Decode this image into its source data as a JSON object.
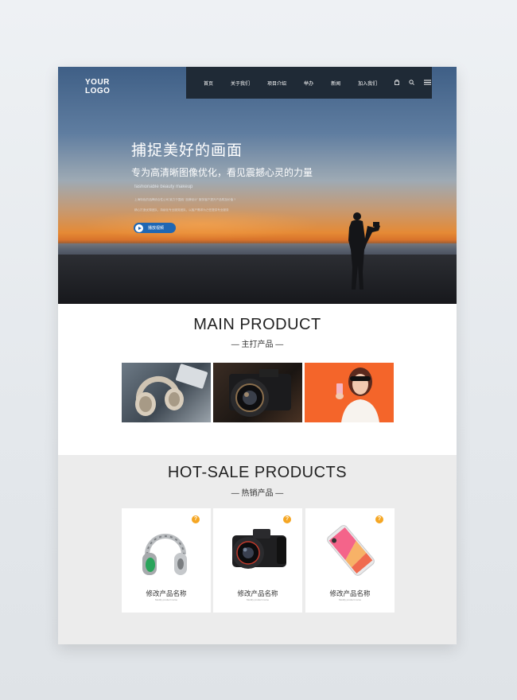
{
  "brand": {
    "logo_line1": "YOUR",
    "logo_line2": "LOGO"
  },
  "nav": {
    "items": [
      "首页",
      "关于我们",
      "项目介绍",
      "举办",
      "新闻",
      "加入我们"
    ],
    "icons": [
      "bag-icon",
      "search-icon",
      "menu-icon"
    ]
  },
  "hero": {
    "title": "捕捉美好的画面",
    "subtitle": "专为高清晰图像优化，看见震撼心灵的力量",
    "tagline": "fashionable beauty makeup",
    "line1": "上海特色的品牌综合性公司 致力于围绕 \"品牌设计\" 服务客户提升产品附加价值 ?",
    "line2": "精心打造优秀团队，持续化专业服务团队，以客户需求为己任提供专业服务",
    "play_label": "播放视频"
  },
  "main_product": {
    "title": "MAIN PRODUCT",
    "subtitle": "— 主打产品 —"
  },
  "hot_sale": {
    "title": "HOT-SALE PRODUCTS",
    "subtitle": "— 热销产品 —",
    "cards": [
      {
        "name": "修改产品名称",
        "en": "Modify product name",
        "badge": "?"
      },
      {
        "name": "修改产品名称",
        "en": "Modify product name",
        "badge": "?"
      },
      {
        "name": "修改产品名称",
        "en": "Modify product name",
        "badge": "?"
      }
    ]
  },
  "colors": {
    "nav_bg": "#1f2a36",
    "play_button": "#1f67b3",
    "badge": "#f5a623",
    "gray_band": "#ececec"
  }
}
